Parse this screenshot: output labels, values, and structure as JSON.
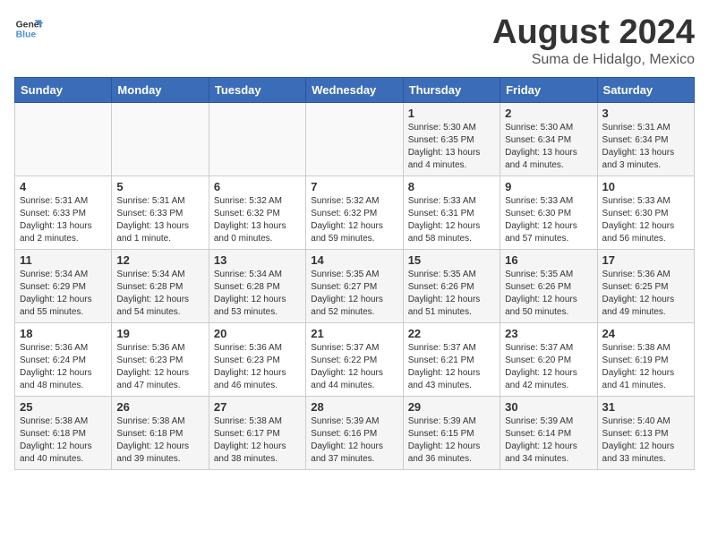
{
  "header": {
    "logo_line1": "General",
    "logo_line2": "Blue",
    "title": "August 2024",
    "subtitle": "Suma de Hidalgo, Mexico"
  },
  "calendar": {
    "days_of_week": [
      "Sunday",
      "Monday",
      "Tuesday",
      "Wednesday",
      "Thursday",
      "Friday",
      "Saturday"
    ],
    "weeks": [
      [
        {
          "day": "",
          "info": ""
        },
        {
          "day": "",
          "info": ""
        },
        {
          "day": "",
          "info": ""
        },
        {
          "day": "",
          "info": ""
        },
        {
          "day": "1",
          "info": "Sunrise: 5:30 AM\nSunset: 6:35 PM\nDaylight: 13 hours\nand 4 minutes."
        },
        {
          "day": "2",
          "info": "Sunrise: 5:30 AM\nSunset: 6:34 PM\nDaylight: 13 hours\nand 4 minutes."
        },
        {
          "day": "3",
          "info": "Sunrise: 5:31 AM\nSunset: 6:34 PM\nDaylight: 13 hours\nand 3 minutes."
        }
      ],
      [
        {
          "day": "4",
          "info": "Sunrise: 5:31 AM\nSunset: 6:33 PM\nDaylight: 13 hours\nand 2 minutes."
        },
        {
          "day": "5",
          "info": "Sunrise: 5:31 AM\nSunset: 6:33 PM\nDaylight: 13 hours\nand 1 minute."
        },
        {
          "day": "6",
          "info": "Sunrise: 5:32 AM\nSunset: 6:32 PM\nDaylight: 13 hours\nand 0 minutes."
        },
        {
          "day": "7",
          "info": "Sunrise: 5:32 AM\nSunset: 6:32 PM\nDaylight: 12 hours\nand 59 minutes."
        },
        {
          "day": "8",
          "info": "Sunrise: 5:33 AM\nSunset: 6:31 PM\nDaylight: 12 hours\nand 58 minutes."
        },
        {
          "day": "9",
          "info": "Sunrise: 5:33 AM\nSunset: 6:30 PM\nDaylight: 12 hours\nand 57 minutes."
        },
        {
          "day": "10",
          "info": "Sunrise: 5:33 AM\nSunset: 6:30 PM\nDaylight: 12 hours\nand 56 minutes."
        }
      ],
      [
        {
          "day": "11",
          "info": "Sunrise: 5:34 AM\nSunset: 6:29 PM\nDaylight: 12 hours\nand 55 minutes."
        },
        {
          "day": "12",
          "info": "Sunrise: 5:34 AM\nSunset: 6:28 PM\nDaylight: 12 hours\nand 54 minutes."
        },
        {
          "day": "13",
          "info": "Sunrise: 5:34 AM\nSunset: 6:28 PM\nDaylight: 12 hours\nand 53 minutes."
        },
        {
          "day": "14",
          "info": "Sunrise: 5:35 AM\nSunset: 6:27 PM\nDaylight: 12 hours\nand 52 minutes."
        },
        {
          "day": "15",
          "info": "Sunrise: 5:35 AM\nSunset: 6:26 PM\nDaylight: 12 hours\nand 51 minutes."
        },
        {
          "day": "16",
          "info": "Sunrise: 5:35 AM\nSunset: 6:26 PM\nDaylight: 12 hours\nand 50 minutes."
        },
        {
          "day": "17",
          "info": "Sunrise: 5:36 AM\nSunset: 6:25 PM\nDaylight: 12 hours\nand 49 minutes."
        }
      ],
      [
        {
          "day": "18",
          "info": "Sunrise: 5:36 AM\nSunset: 6:24 PM\nDaylight: 12 hours\nand 48 minutes."
        },
        {
          "day": "19",
          "info": "Sunrise: 5:36 AM\nSunset: 6:23 PM\nDaylight: 12 hours\nand 47 minutes."
        },
        {
          "day": "20",
          "info": "Sunrise: 5:36 AM\nSunset: 6:23 PM\nDaylight: 12 hours\nand 46 minutes."
        },
        {
          "day": "21",
          "info": "Sunrise: 5:37 AM\nSunset: 6:22 PM\nDaylight: 12 hours\nand 44 minutes."
        },
        {
          "day": "22",
          "info": "Sunrise: 5:37 AM\nSunset: 6:21 PM\nDaylight: 12 hours\nand 43 minutes."
        },
        {
          "day": "23",
          "info": "Sunrise: 5:37 AM\nSunset: 6:20 PM\nDaylight: 12 hours\nand 42 minutes."
        },
        {
          "day": "24",
          "info": "Sunrise: 5:38 AM\nSunset: 6:19 PM\nDaylight: 12 hours\nand 41 minutes."
        }
      ],
      [
        {
          "day": "25",
          "info": "Sunrise: 5:38 AM\nSunset: 6:18 PM\nDaylight: 12 hours\nand 40 minutes."
        },
        {
          "day": "26",
          "info": "Sunrise: 5:38 AM\nSunset: 6:18 PM\nDaylight: 12 hours\nand 39 minutes."
        },
        {
          "day": "27",
          "info": "Sunrise: 5:38 AM\nSunset: 6:17 PM\nDaylight: 12 hours\nand 38 minutes."
        },
        {
          "day": "28",
          "info": "Sunrise: 5:39 AM\nSunset: 6:16 PM\nDaylight: 12 hours\nand 37 minutes."
        },
        {
          "day": "29",
          "info": "Sunrise: 5:39 AM\nSunset: 6:15 PM\nDaylight: 12 hours\nand 36 minutes."
        },
        {
          "day": "30",
          "info": "Sunrise: 5:39 AM\nSunset: 6:14 PM\nDaylight: 12 hours\nand 34 minutes."
        },
        {
          "day": "31",
          "info": "Sunrise: 5:40 AM\nSunset: 6:13 PM\nDaylight: 12 hours\nand 33 minutes."
        }
      ]
    ]
  }
}
